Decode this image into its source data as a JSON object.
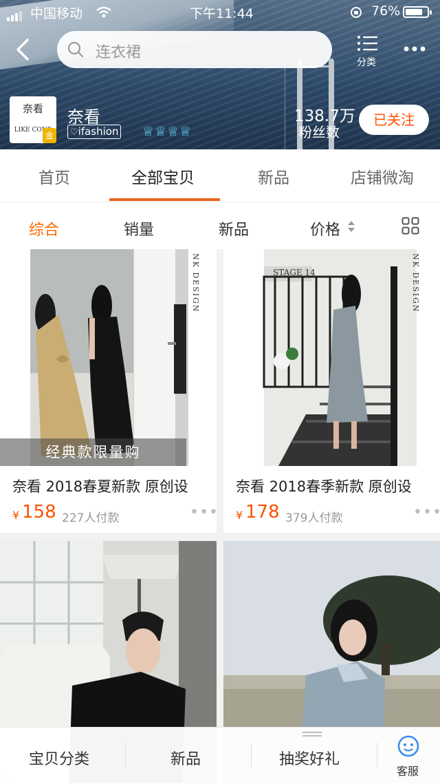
{
  "status_bar": {
    "carrier": "中国移动",
    "time": "下午11:44",
    "battery": "76%"
  },
  "header": {
    "search_placeholder": "连衣裙",
    "category_label": "分类"
  },
  "shop": {
    "logo_cn": "奈看",
    "logo_en": "LIKE CONE",
    "logo_badge": "金",
    "name": "奈看",
    "tag": "ifashion",
    "crowns": "♕♕♕♕",
    "fans_count": "138.7万",
    "fans_label": "粉丝数",
    "follow_label": "已关注"
  },
  "tabs": [
    "首页",
    "全部宝贝",
    "新品",
    "店铺微淘"
  ],
  "active_tab": "全部宝贝",
  "sort": {
    "items": [
      "综合",
      "销量",
      "新品",
      "价格"
    ],
    "active": "综合"
  },
  "products": [
    {
      "title": "奈看 2018春夏新款 原创设",
      "price": "158",
      "sold": "227人付款",
      "badge": "经典款限量购",
      "brand_vertical": "NK DESIGN"
    },
    {
      "title": "奈看 2018春季新款 原创设",
      "price": "178",
      "sold": "379人付款",
      "brand_vertical": "NK DESIGN",
      "sign_text": "STAGE 14"
    },
    {
      "title": "",
      "price": "",
      "sold": ""
    },
    {
      "title": "",
      "price": "",
      "sold": ""
    }
  ],
  "currency": "¥",
  "bottom_bar": {
    "items": [
      "宝贝分类",
      "新品",
      "抽奖好礼"
    ],
    "service": "客服"
  },
  "colors": {
    "accent": "#ff5000",
    "tab_indicator": "#e8651e"
  }
}
